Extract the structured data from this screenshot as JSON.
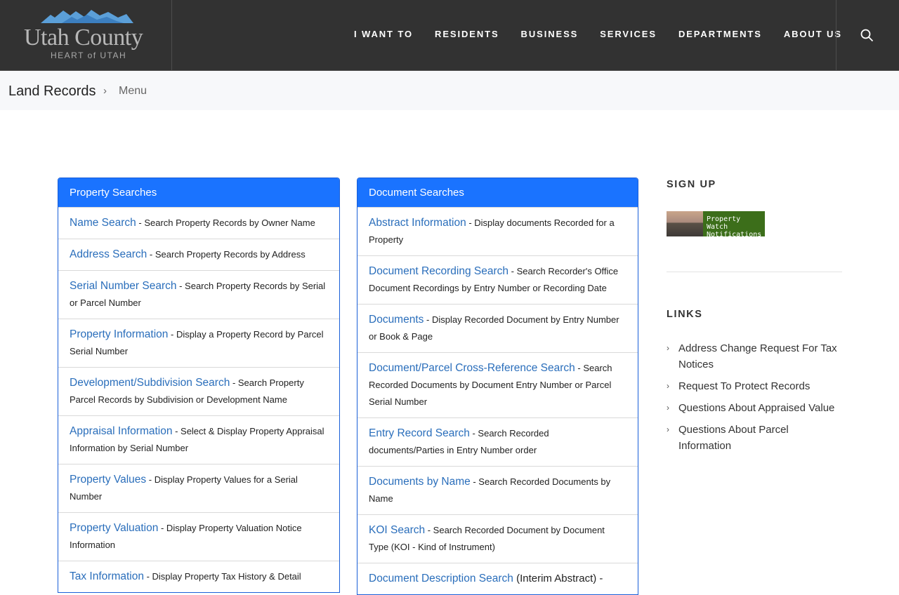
{
  "header": {
    "logo_name": "Utah County",
    "logo_tag": "HEART of UTAH",
    "nav": [
      "I WANT TO",
      "RESIDENTS",
      "BUSINESS",
      "SERVICES",
      "DEPARTMENTS",
      "ABOUT US"
    ]
  },
  "breadcrumb": {
    "title": "Land Records",
    "separator": "›",
    "current": "Menu"
  },
  "property_panel": {
    "title": "Property Searches",
    "items": [
      {
        "link": "Name Search",
        "desc": " - Search Property Records by Owner Name"
      },
      {
        "link": "Address Search",
        "desc": " - Search Property Records by Address"
      },
      {
        "link": "Serial Number Search",
        "desc": " - Search Property Records by Serial or Parcel Number"
      },
      {
        "link": "Property Information",
        "desc": " - Display a Property Record by Parcel Serial Number"
      },
      {
        "link": "Development/Subdivision Search",
        "desc": " - Search Property Parcel Records by Subdivision or Development Name"
      },
      {
        "link": "Appraisal Information",
        "desc": " - Select & Display Property Appraisal Information by Serial Number"
      },
      {
        "link": "Property Values",
        "desc": " - Display Property Values for a Serial Number"
      },
      {
        "link": "Property Valuation",
        "desc": " - Display Property Valuation Notice Information"
      },
      {
        "link": "Tax Information",
        "desc": " - Display Property Tax History & Detail"
      }
    ]
  },
  "document_panel": {
    "title": "Document Searches",
    "items": [
      {
        "link": "Abstract Information",
        "desc": " - Display documents Recorded for a Property"
      },
      {
        "link": "Document Recording Search",
        "desc": " - Search Recorder's Office Document Recordings by Entry Number or Recording Date"
      },
      {
        "link": "Documents",
        "desc": " - Display Recorded Document by Entry Number or Book & Page"
      },
      {
        "link": "Document/Parcel Cross-Reference Search",
        "desc": " - Search Recorded Documents by Document Entry Number or Parcel Serial Number"
      },
      {
        "link": "Entry Record Search",
        "desc": " - Search Recorded documents/Parties in Entry Number order"
      },
      {
        "link": "Documents by Name",
        "desc": " - Search Recorded Documents by Name"
      },
      {
        "link": "KOI Search",
        "desc": " - Search Recorded Document by Document Type (KOI - Kind of Instrument)"
      },
      {
        "link": "Document Description Search",
        "desc": " (Interim Abstract) -"
      }
    ]
  },
  "sidebar": {
    "signup_heading": "SIGN UP",
    "banner_text": "Property Watch Notifications",
    "links_heading": "LINKS",
    "links": [
      "Address Change Request For Tax Notices",
      "Request To Protect Records",
      "Questions About Appraised Value",
      "Questions About Parcel Information"
    ]
  }
}
